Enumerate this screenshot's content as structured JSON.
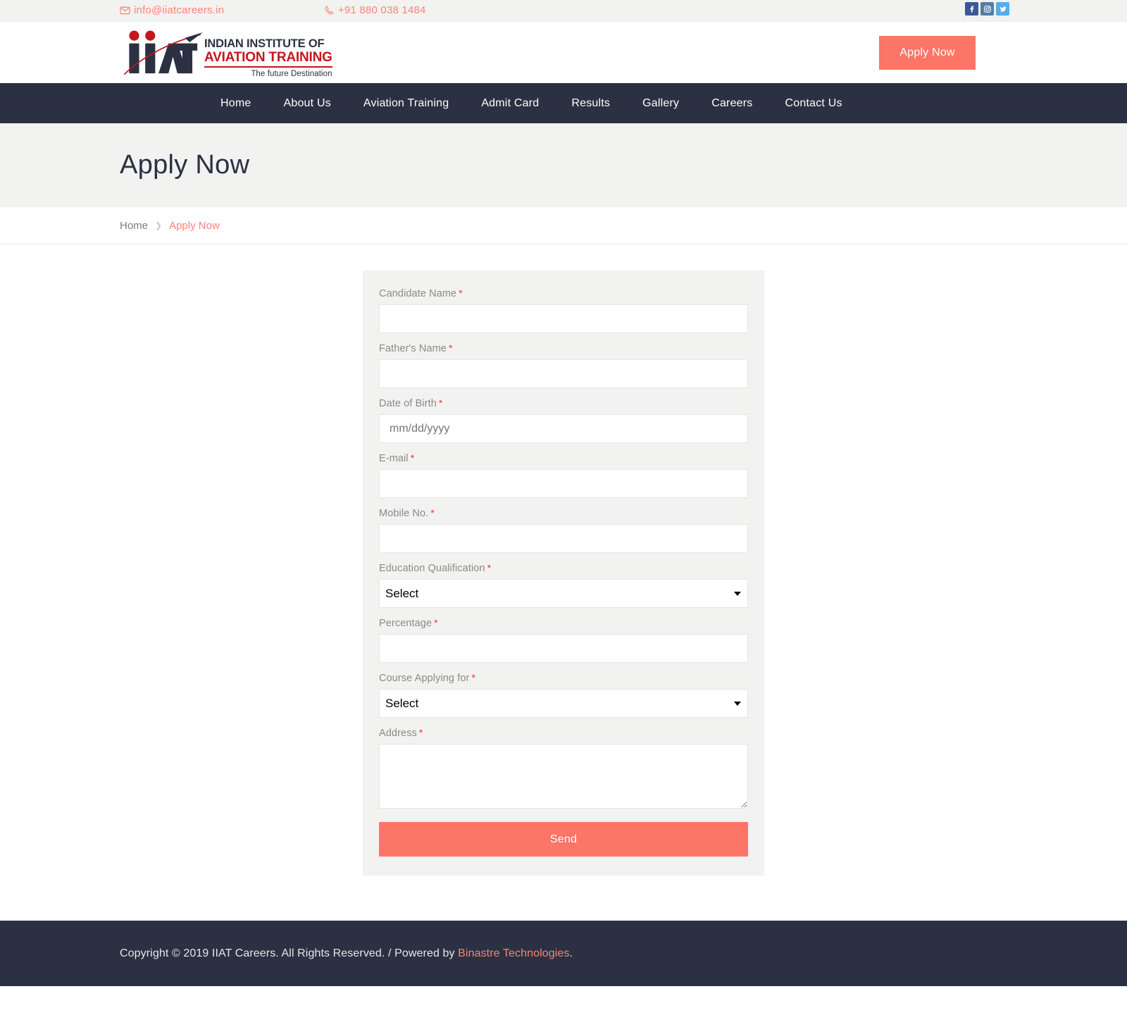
{
  "topbar": {
    "email": "info@iiatcareers.in",
    "phone": "+91 880 038 1484",
    "email_icon": "envelope-icon",
    "phone_icon": "phone-icon",
    "social": [
      {
        "name": "facebook",
        "glyph": "f",
        "color": "#3b5998"
      },
      {
        "name": "instagram",
        "glyph": "",
        "color": "#517fa4"
      },
      {
        "name": "twitter",
        "glyph": "",
        "color": "#55acee"
      }
    ]
  },
  "header": {
    "logo": {
      "monogram": "iIAT",
      "line1": "INDIAN INSTITUTE OF",
      "line2": "AVIATION TRAINING",
      "tagline": "The future Destination"
    },
    "apply_button": "Apply Now"
  },
  "nav": {
    "items": [
      {
        "label": "Home"
      },
      {
        "label": "About Us"
      },
      {
        "label": "Aviation Training"
      },
      {
        "label": "Admit Card"
      },
      {
        "label": "Results"
      },
      {
        "label": "Gallery"
      },
      {
        "label": "Careers"
      },
      {
        "label": "Contact Us"
      }
    ]
  },
  "page": {
    "title": "Apply Now",
    "breadcrumb": {
      "home": "Home",
      "separator": "❯",
      "current": "Apply Now"
    }
  },
  "form": {
    "fields": {
      "candidate_name": {
        "label": "Candidate Name",
        "required": "*",
        "value": ""
      },
      "fathers_name": {
        "label": "Father's Name",
        "required": "*",
        "value": ""
      },
      "date_of_birth": {
        "label": "Date of Birth",
        "required": "*",
        "placeholder": "mm/dd/yyyy",
        "value": ""
      },
      "email": {
        "label": "E-mail",
        "required": "*",
        "value": ""
      },
      "mobile": {
        "label": "Mobile No.",
        "required": "*",
        "value": ""
      },
      "education": {
        "label": "Education Qualification",
        "required": "*",
        "selected": "Select"
      },
      "percentage": {
        "label": "Percentage",
        "required": "*",
        "value": ""
      },
      "course": {
        "label": "Course Applying for",
        "required": "*",
        "selected": "Select"
      },
      "address": {
        "label": "Address",
        "required": "*",
        "value": ""
      }
    },
    "submit_label": "Send"
  },
  "footer": {
    "copyright": "Copyright © 2019 IIAT Careers. All Rights Reserved. / Powered by ",
    "company": "Binastre Technologies",
    "period": "."
  },
  "colors": {
    "accent": "#fc7566",
    "accent_light": "#fb8376",
    "dark": "#2b3042",
    "band": "#f2f2f1",
    "logo_red": "#c4161c"
  }
}
